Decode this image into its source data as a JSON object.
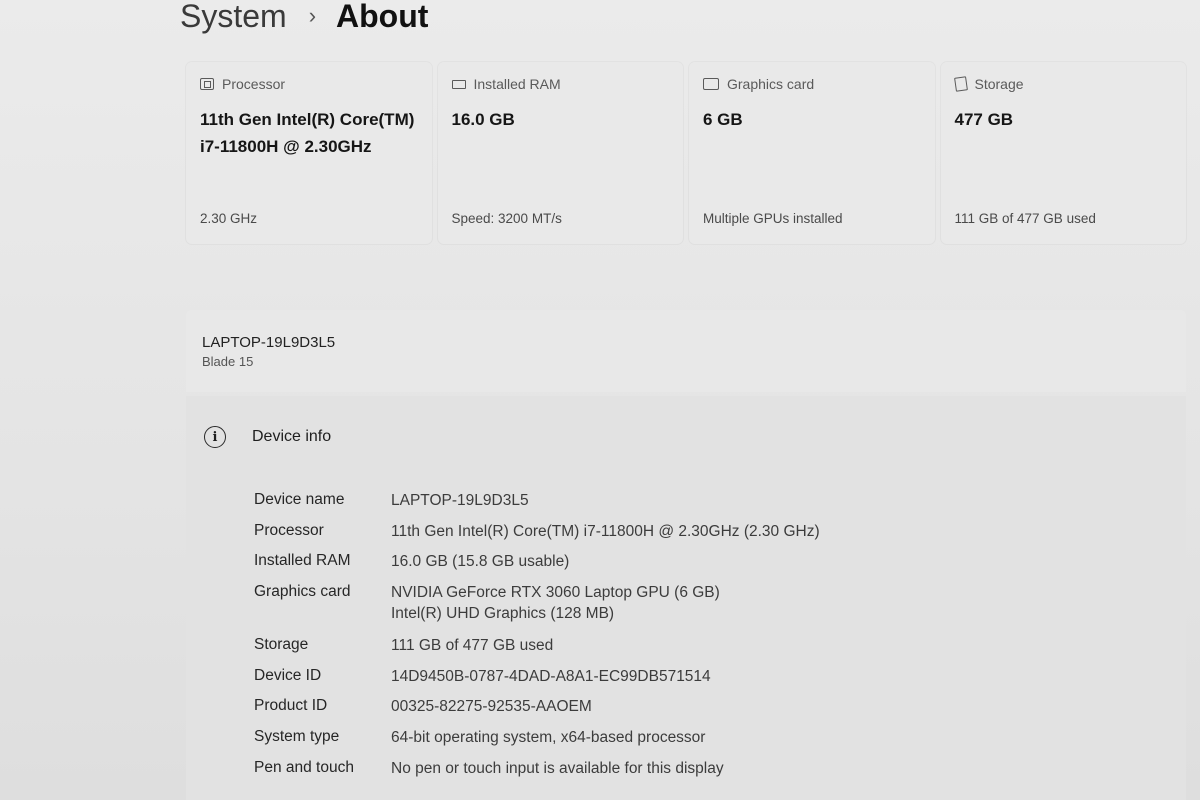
{
  "breadcrumb": {
    "parent": "System",
    "separator": "›",
    "current": "About"
  },
  "cards": [
    {
      "icon": "processor-icon",
      "title": "Processor",
      "value": "11th Gen Intel(R) Core(TM) i7-11800H @ 2.30GHz",
      "sub": "2.30 GHz"
    },
    {
      "icon": "ram-icon",
      "title": "Installed RAM",
      "value": "16.0 GB",
      "sub": "Speed: 3200 MT/s"
    },
    {
      "icon": "graphics-card-icon",
      "title": "Graphics card",
      "value": "6 GB",
      "sub": "Multiple GPUs installed"
    },
    {
      "icon": "storage-icon",
      "title": "Storage",
      "value": "477 GB",
      "sub": "111 GB of 477 GB used"
    }
  ],
  "device": {
    "hostname": "LAPTOP-19L9D3L5",
    "model": "Blade 15"
  },
  "device_info": {
    "title": "Device info",
    "icon": "info-icon",
    "rows": [
      {
        "label": "Device name",
        "value": "LAPTOP-19L9D3L5"
      },
      {
        "label": "Processor",
        "value": "11th Gen Intel(R) Core(TM) i7-11800H @ 2.30GHz (2.30 GHz)"
      },
      {
        "label": "Installed RAM",
        "value": "16.0 GB (15.8 GB usable)"
      },
      {
        "label": "Graphics card",
        "value": "NVIDIA GeForce RTX 3060 Laptop GPU (6 GB)",
        "value2": "Intel(R) UHD Graphics (128 MB)"
      },
      {
        "label": "Storage",
        "value": "111 GB of 477 GB used"
      },
      {
        "label": "Device ID",
        "value": "14D9450B-0787-4DAD-A8A1-EC99DB571514"
      },
      {
        "label": "Product ID",
        "value": "00325-82275-92535-AAOEM"
      },
      {
        "label": "System type",
        "value": "64-bit operating system, x64-based processor"
      },
      {
        "label": "Pen and touch",
        "value": "No pen or touch input is available for this display"
      }
    ]
  }
}
